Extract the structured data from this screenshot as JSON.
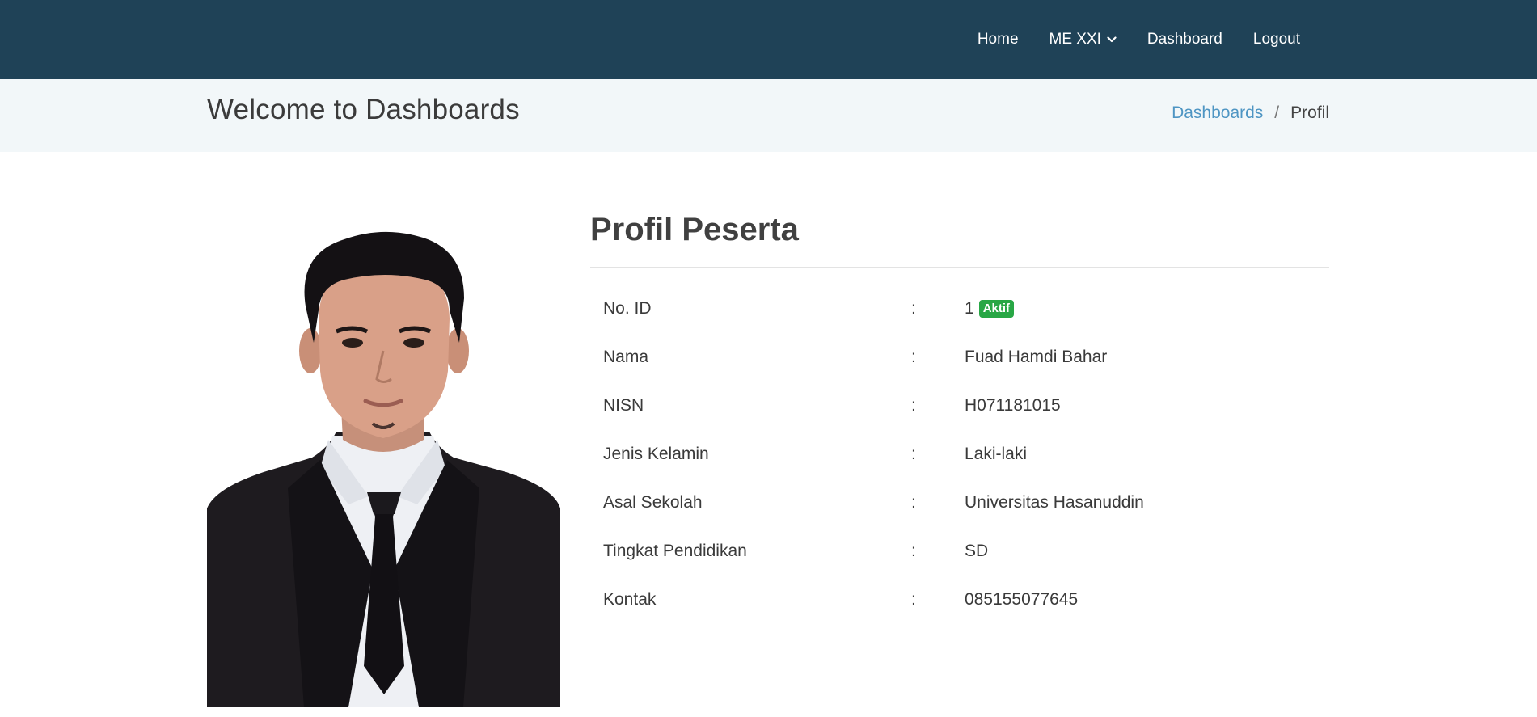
{
  "navbar": {
    "items": [
      {
        "label": "Home"
      },
      {
        "label": "ME XXI",
        "has_dropdown": true,
        "icon": "chevron-down-icon"
      },
      {
        "label": "Dashboard"
      },
      {
        "label": "Logout"
      }
    ],
    "background": "#1f4257"
  },
  "header": {
    "title": "Welcome to Dashboards",
    "breadcrumb": {
      "link": "Dashboards",
      "separator": "/",
      "current": "Profil"
    }
  },
  "profile": {
    "title": "Profil Peserta",
    "photo_alt": "profile-photo",
    "rows": [
      {
        "label": "No. ID",
        "colon": ":",
        "value": "1",
        "badge": "Aktif"
      },
      {
        "label": "Nama",
        "colon": ":",
        "value": "Fuad Hamdi Bahar"
      },
      {
        "label": "NISN",
        "colon": ":",
        "value": "H071181015"
      },
      {
        "label": "Jenis Kelamin",
        "colon": ":",
        "value": "Laki-laki"
      },
      {
        "label": "Asal Sekolah",
        "colon": ":",
        "value": "Universitas Hasanuddin"
      },
      {
        "label": "Tingkat Pendidikan",
        "colon": ":",
        "value": "SD"
      },
      {
        "label": "Kontak",
        "colon": ":",
        "value": "085155077645"
      }
    ]
  },
  "colors": {
    "accent_link": "#4e95c3",
    "badge_success": "#28a745",
    "band_bg": "#f2f7f9"
  }
}
